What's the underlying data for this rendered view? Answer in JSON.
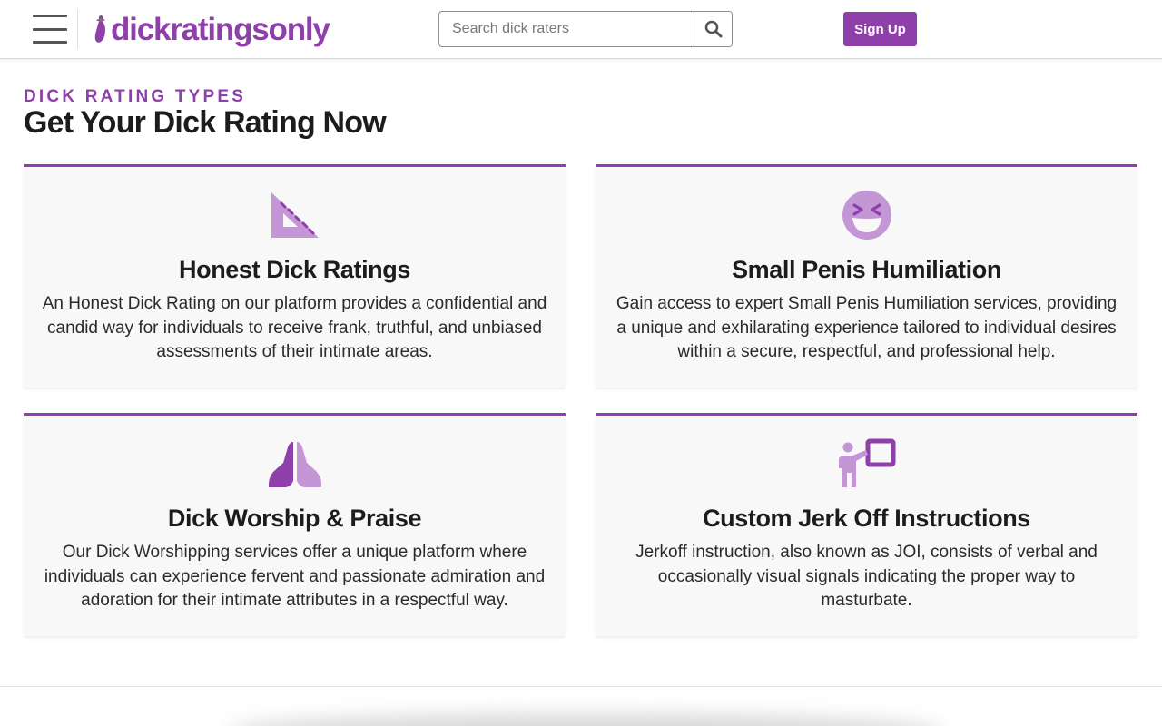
{
  "header": {
    "logo_text": "dickratingsonly",
    "search_placeholder": "Search dick raters",
    "signup_label": "Sign Up"
  },
  "section": {
    "eyebrow": "DICK RATING TYPES",
    "title": "Get Your Dick Rating Now"
  },
  "cards": [
    {
      "icon": "ruler-triangle-icon",
      "title": "Honest Dick Ratings",
      "description": "An Honest Dick Rating on our platform provides a confidential and candid way for individuals to receive frank, truthful, and unbiased assessments of their intimate areas."
    },
    {
      "icon": "laughing-face-icon",
      "title": "Small Penis Humiliation",
      "description": "Gain access to expert Small Penis Humiliation services, providing a unique and exhilarating experience tailored to individual desires within a secure, respectful, and professional help."
    },
    {
      "icon": "praying-hands-icon",
      "title": "Dick Worship & Praise",
      "description": "Our Dick Worshipping services offer a unique platform where individuals can experience fervent and passionate admiration and adoration for their intimate attributes in a respectful way."
    },
    {
      "icon": "instructor-board-icon",
      "title": "Custom Jerk Off Instructions",
      "description": "Jerkoff instruction, also known as JOI, consists of verbal and occasionally visual signals indicating the proper way to masturbate."
    }
  ],
  "colors": {
    "accent": "#8e3fa9",
    "icon_light": "#c596d6"
  }
}
